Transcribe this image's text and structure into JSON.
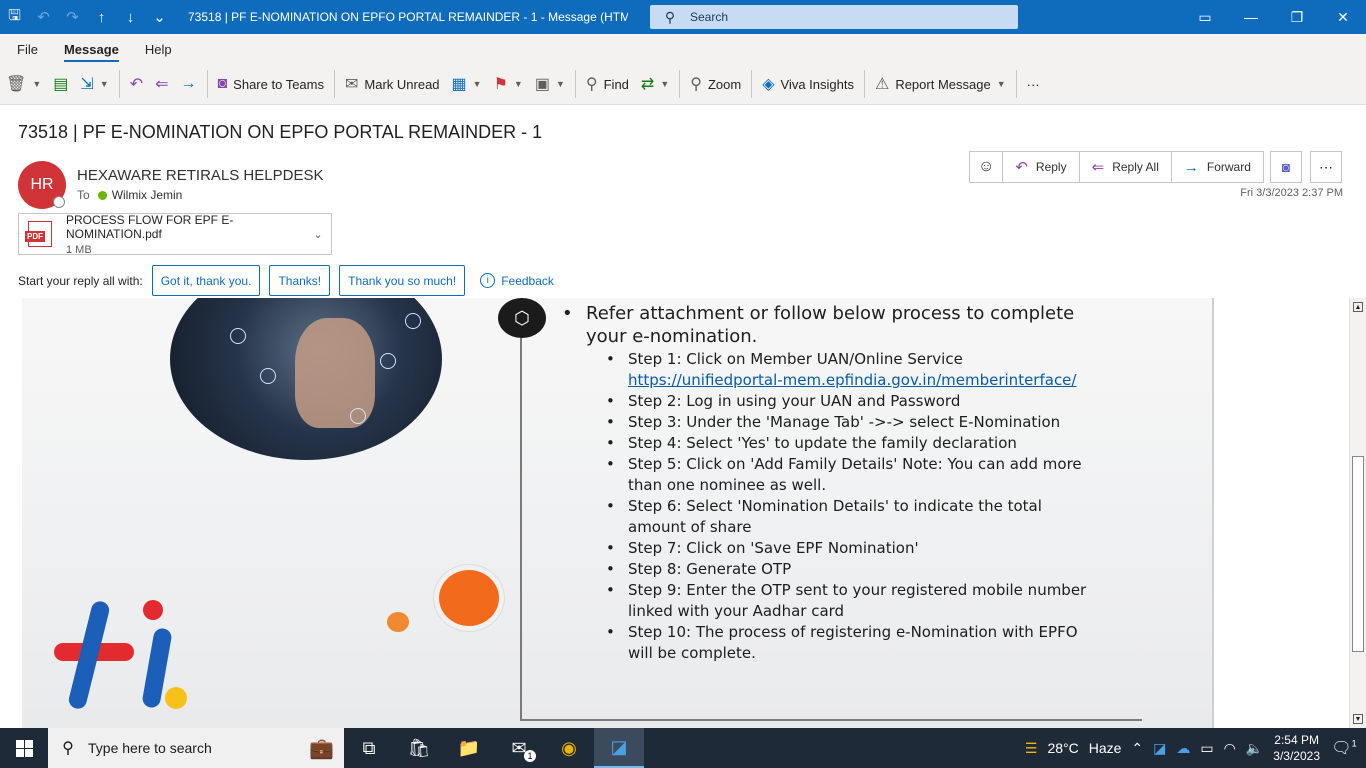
{
  "titlebar": {
    "title": "73518 | PF E-NOMINATION ON EPFO PORTAL REMAINDER - 1  -  Message (HTML)",
    "search_placeholder": "Search",
    "accent": "#0f6cbd"
  },
  "menu": {
    "items": [
      "File",
      "Message",
      "Help"
    ],
    "active": "Message"
  },
  "ribbon": {
    "share_to_teams": "Share to Teams",
    "mark_unread": "Mark Unread",
    "find": "Find",
    "zoom": "Zoom",
    "viva_insights": "Viva Insights",
    "report_message": "Report Message",
    "more": "···"
  },
  "message": {
    "subject": "73518 | PF E-NOMINATION ON EPFO PORTAL REMAINDER - 1",
    "avatar_initials": "HR",
    "sender": "HEXAWARE RETIRALS HELPDESK",
    "to_label": "To",
    "recipient": "Wilmix Jemin",
    "date": "Fri 3/3/2023 2:37 PM"
  },
  "actions": {
    "reply": "Reply",
    "reply_all": "Reply All",
    "forward": "Forward"
  },
  "attachment": {
    "name": "PROCESS FLOW FOR EPF E-NOMINATION.pdf",
    "size": "1 MB",
    "type_label": "PDF"
  },
  "quick_replies": {
    "label": "Start your reply all with:",
    "options": [
      "Got it, thank you.",
      "Thanks!",
      "Thank you so much!"
    ],
    "feedback": "Feedback"
  },
  "body": {
    "lead": "Refer attachment or follow below process to complete your e-nomination.",
    "step1_text": "Step 1: Click on Member UAN/Online Service",
    "step1_link": "https://unifiedportal-mem.epfindia.gov.in/memberinterface/",
    "steps": [
      "Step 2: Log in using your UAN and Password",
      "Step 3: Under the 'Manage Tab' ->-> select E-Nomination",
      "Step 4: Select 'Yes' to update the family declaration",
      "Step 5: Click on 'Add Family Details' Note: You can add more than one nominee as well.",
      "Step 6: Select 'Nomination Details' to indicate the total amount of share",
      "Step 7: Click on 'Save EPF Nomination'",
      "Step 8: Generate OTP",
      "Step 9: Enter the OTP sent to your registered mobile number linked with your Aadhar card",
      "Step 10: The process of registering e-Nomination with EPFO will be complete."
    ]
  },
  "taskbar": {
    "search_placeholder": "Type here to search",
    "weather_temp": "28°C",
    "weather_desc": "Haze",
    "time": "2:54 PM",
    "date": "3/3/2023",
    "mail_badge": "1",
    "notif_badge": "1"
  }
}
